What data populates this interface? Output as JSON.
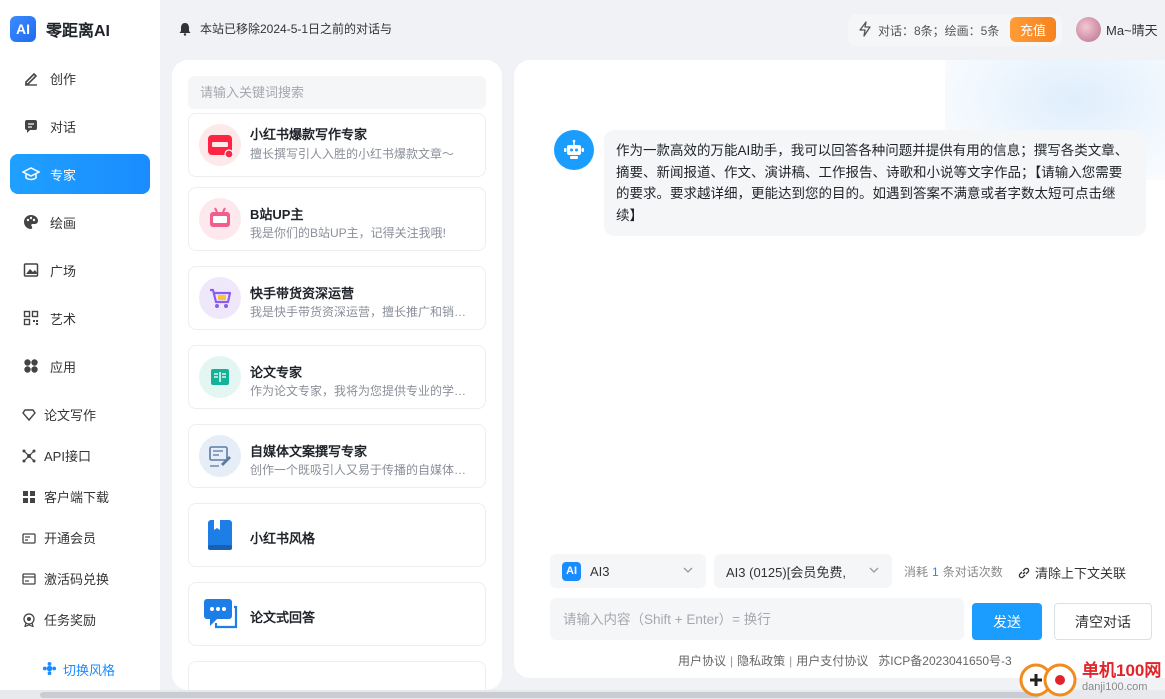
{
  "app": {
    "logo_badge": "AI",
    "name": "零距离AI"
  },
  "sidebar": {
    "nav": [
      {
        "label": "创作",
        "icon": "pen-icon"
      },
      {
        "label": "对话",
        "icon": "chat-icon"
      },
      {
        "label": "专家",
        "icon": "graduation-cap-icon",
        "active": true
      },
      {
        "label": "绘画",
        "icon": "palette-icon"
      },
      {
        "label": "广场",
        "icon": "image-icon"
      },
      {
        "label": "艺术",
        "icon": "qr-code-icon"
      },
      {
        "label": "应用",
        "icon": "apps-icon"
      }
    ],
    "secondary": [
      {
        "label": "论文写作",
        "icon": "diamond-icon"
      },
      {
        "label": "API接口",
        "icon": "api-icon"
      },
      {
        "label": "客户端下载",
        "icon": "grid-icon"
      },
      {
        "label": "开通会员",
        "icon": "vip-card-icon"
      },
      {
        "label": "激活码兑换",
        "icon": "ticket-icon"
      },
      {
        "label": "任务奖励",
        "icon": "award-icon"
      }
    ],
    "switch_style": "切换风格"
  },
  "header": {
    "notice": "本站已移除2024-5-1日之前的对话与",
    "stats": "对话：8条；绘画：5条",
    "recharge": "充值",
    "username": "Ma~晴天"
  },
  "experts": {
    "search_placeholder": "请输入关键词搜索",
    "cards": [
      {
        "title": "小红书爆款写作专家",
        "desc": "擅长撰写引人入胜的小红书爆款文章～",
        "icon": "xiaohongshu-icon"
      },
      {
        "title": "B站UP主",
        "desc": "我是你们的B站UP主，记得关注我哦!",
        "icon": "bilibili-icon"
      },
      {
        "title": "快手带货资深运营",
        "desc": "我是快手带货资深运营，擅长推广和销售商品",
        "icon": "shopping-cart-icon"
      },
      {
        "title": "论文专家",
        "desc": "作为论文专家，我将为您提供专业的学术建议",
        "icon": "book-open-icon"
      },
      {
        "title": "自媒体文案撰写专家",
        "desc": "创作一个既吸引人又易于传播的自媒体文案",
        "icon": "media-writing-icon"
      },
      {
        "title": "小红书风格",
        "desc": "",
        "icon": "blue-book-icon"
      },
      {
        "title": "论文式回答",
        "desc": "",
        "icon": "message-bubbles-icon"
      }
    ]
  },
  "chat": {
    "welcome": "作为一款高效的万能AI助手，我可以回答各种问题并提供有用的信息；撰写各类文章、摘要、新闻报道、作文、演讲稿、工作报告、诗歌和小说等文字作品；【请输入您需要的要求。要求越详细，更能达到您的目的。如遇到答案不满意或者字数太短可点击继续】",
    "model_badge": "AI",
    "model": "AI3",
    "version": "AI3 (0125)[会员免费,",
    "consume_prefix": "消耗",
    "consume_num": "1",
    "consume_suffix": "条对话次数",
    "clear_context": "清除上下文关联",
    "input_placeholder": "请输入内容（Shift + Enter）= 换行",
    "send": "发送",
    "clear_chat": "清空对话",
    "footer": {
      "user_agreement": "用户协议",
      "privacy": "隐私政策",
      "payment": "用户支付协议",
      "icp": "苏ICP备2023041650号-3"
    }
  },
  "watermark": {
    "site": "单机100网",
    "domain": "danji100.com"
  },
  "colors": {
    "accent": "#1a9dff",
    "recharge": "#f6821f"
  }
}
